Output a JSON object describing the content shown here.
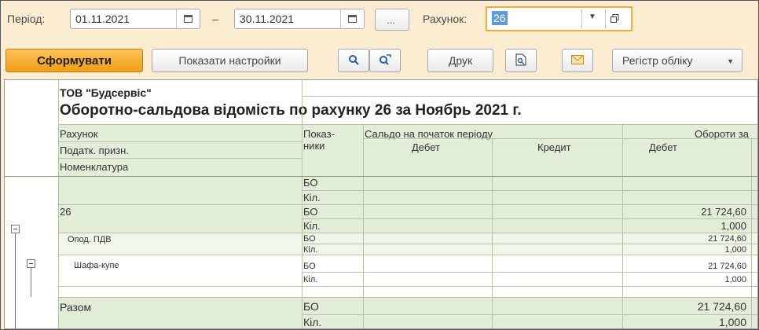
{
  "period": {
    "label": "Період:",
    "from": "01.11.2021",
    "dash": "–",
    "to": "30.11.2021",
    "more_button": "...",
    "account_label": "Рахунок:",
    "account_value": "26"
  },
  "toolbar": {
    "generate": "Сформувати",
    "show_settings": "Показати настройки",
    "print": "Друк",
    "register": "Регістр обліку"
  },
  "report": {
    "company": "ТОВ \"Будсервіс\"",
    "title": "Оборотно-сальдова відомість по рахунку 26 за Ноябрь 2021 г.",
    "headers": {
      "account": "Рахунок",
      "tax_attr": "Податк. призн.",
      "nomenclature": "Номенклатура",
      "indicators_1": "Показ-",
      "indicators_2": "ники",
      "opening_balance": "Сальдо на початок періоду",
      "turnover": "Обороти за",
      "debit": "Дебет",
      "credit": "Кредит",
      "turnover_debit": "Дебет"
    },
    "rows": [
      {
        "name": "",
        "ind1": "БО",
        "ind2": "Кіл.",
        "v1": "",
        "v2": ""
      },
      {
        "name": "26",
        "ind1": "БО",
        "ind2": "Кіл.",
        "v1": "21 724,60",
        "v2": "1,000"
      },
      {
        "name": "Опод. ПДВ",
        "ind1": "БО",
        "ind2": "Кіл.",
        "v1": "21 724,60",
        "v2": "1,000"
      },
      {
        "name": "Шафа-купе",
        "ind1": "БО",
        "ind2": "Кіл.",
        "v1": "21 724,60",
        "v2": "1,000"
      },
      {
        "name": "Разом",
        "ind1": "БО",
        "ind2": "Кіл.",
        "v1": "21 724,60",
        "v2": "1,000"
      }
    ]
  },
  "colors": {
    "panel_bg": "#fbecd2",
    "primary_button": "#f29d13",
    "table_green": "#e3ecd6",
    "selection_blue": "#5e9ad6",
    "focus_orange": "#f4a940"
  }
}
